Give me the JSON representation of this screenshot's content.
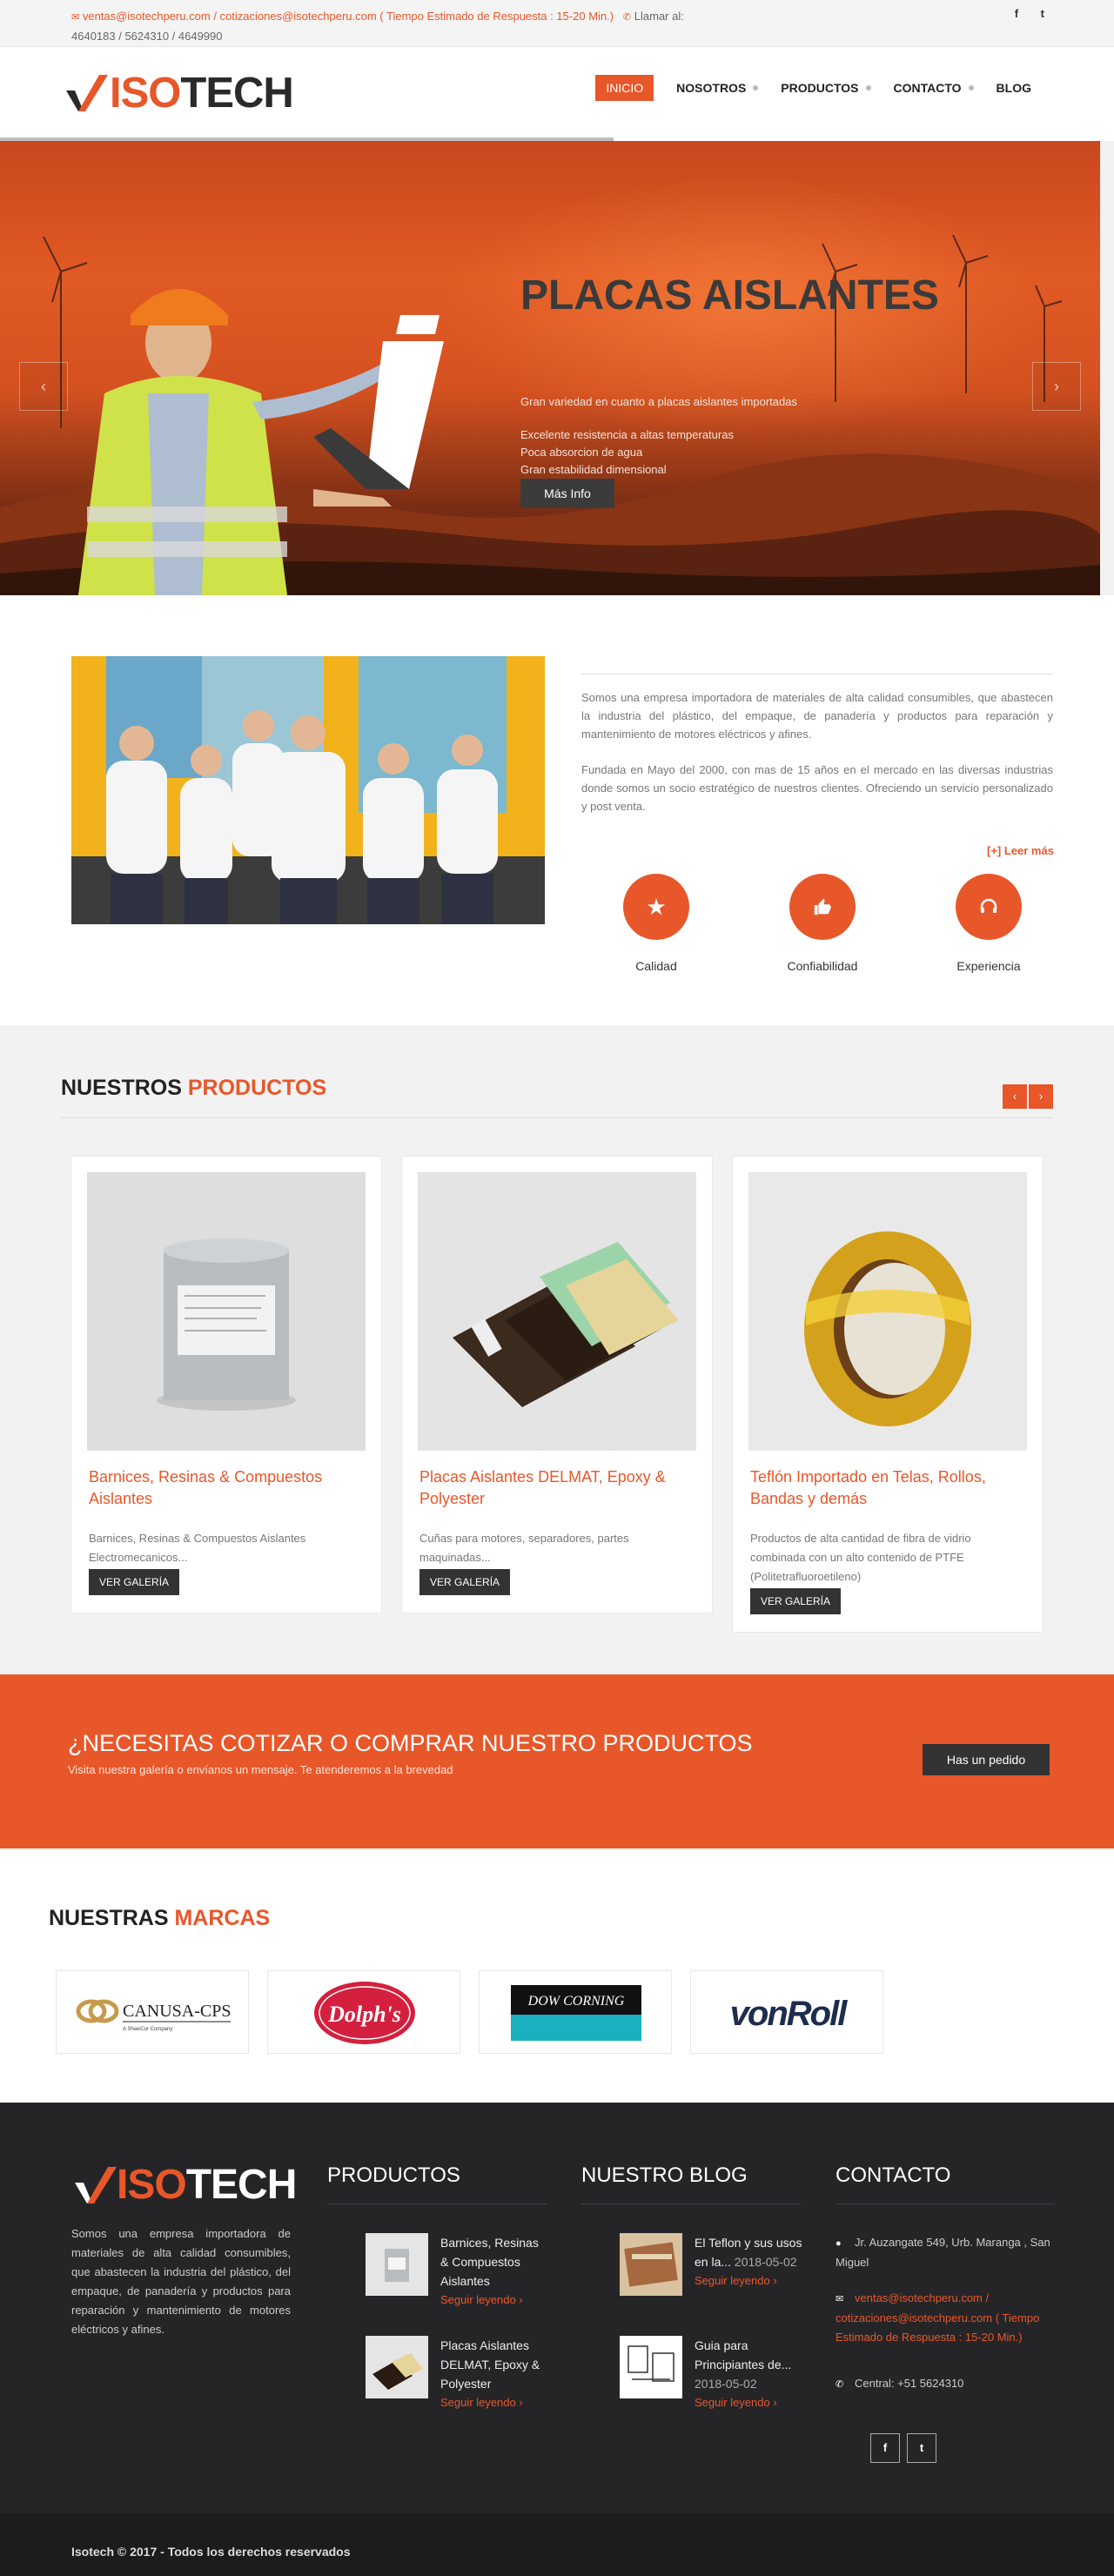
{
  "topbar": {
    "email_text": "ventas@isotechperu.com / cotizaciones@isotechperu.com ( Tiempo Estimado de Respuesta : 15-20 Min.)",
    "call_label": "Llamar al:",
    "phones": "4640183 / 5624310 / 4649990",
    "social": [
      "f",
      "t"
    ]
  },
  "header": {
    "logo_prefix": "ISO",
    "logo_suffix": "TECH",
    "nav": [
      {
        "label": "INICIO"
      },
      {
        "label": "NOSOTROS"
      },
      {
        "label": "PRODUCTOS"
      },
      {
        "label": "CONTACTO"
      },
      {
        "label": "BLOG"
      }
    ]
  },
  "hero": {
    "title": "PLACAS AISLANTES",
    "line1": "Gran variedad en cuanto a placas aislantes importadas",
    "line2": "Excelente resistencia a altas temperaturas",
    "line3": "Poca absorcion de agua",
    "line4": "Gran estabilidad dimensional",
    "button": "Más Info",
    "prev": "‹",
    "next": "›"
  },
  "about": {
    "para1": "Somos una empresa importadora de materiales de alta calidad consumibles, que abastecen la industria del plástico, del empaque, de panadería y productos para reparación y mantenimiento de motores eléctricos y afines.",
    "para2": "Fundada en Mayo del 2000, con mas de 15 años en el mercado en las diversas industrias donde somos un socio estratégico de nuestros clientes. Ofreciendo un servicio personalizado y post venta.",
    "more": "[+] Leer más",
    "features": [
      {
        "label": "Calidad",
        "icon": "star-icon"
      },
      {
        "label": "Confiabilidad",
        "icon": "thumbs-up-icon"
      },
      {
        "label": "Experiencia",
        "icon": "headset-icon"
      }
    ]
  },
  "products": {
    "heading_a": "NUESTROS",
    "heading_b": "PRODUCTOS",
    "prev": "‹",
    "next": "›",
    "items": [
      {
        "title": "Barnices, Resinas & Compuestos Aislantes",
        "desc": "Barnices, Resinas & Compuestos Aislantes Electromecanicos...",
        "button": "VER GALERÍA"
      },
      {
        "title": "Placas Aislantes DELMAT, Epoxy & Polyester",
        "desc": "Cuñas para motores, separadores, partes maquinadas...",
        "button": "VER GALERÍA"
      },
      {
        "title": "Teflón Importado en Telas, Rollos, Bandas y demás",
        "desc": "Productos de alta cantidad de fibra de vidrio combinada con un alto contenido de PTFE (Politetrafluoroetileno)",
        "button": "VER GALERÍA"
      }
    ]
  },
  "cta": {
    "title": "¿NECESITAS COTIZAR O COMPRAR NUESTRO PRODUCTOS",
    "subtitle": "Visita nuestra galería o envíanos un mensaje. Te atenderemos a la brevedad",
    "button": "Has un pedido"
  },
  "brands": {
    "heading_a": "NUESTRAS",
    "heading_b": "MARCAS",
    "items": [
      "CANUSA-CPS",
      "Dolph's",
      "DOW CORNING",
      "vonRoll"
    ],
    "canusa_sub": "A ShawCor Company"
  },
  "footer": {
    "logo_prefix": "ISO",
    "logo_suffix": "TECH",
    "about": "Somos una empresa importadora de materiales de alta calidad consumibles, que abastecen la industria del plástico, del empaque, de panadería y productos para reparación y mantenimiento de motores eléctricos y afines.",
    "products_title": "PRODUCTOS",
    "products": [
      {
        "title": "Barnices, Resinas & Compuestos Aislantes",
        "more": "Seguir leyendo ›"
      },
      {
        "title": "Placas Aislantes DELMAT, Epoxy & Polyester",
        "more": "Seguir leyendo ›"
      }
    ],
    "blog_title": "NUESTRO BLOG",
    "blog": [
      {
        "title": "El Teflon y sus usos en la...",
        "date": "2018-05-02",
        "more": "Seguir leyendo ›"
      },
      {
        "title": "Guia para Principiantes de...",
        "date": "2018-05-02",
        "more": "Seguir leyendo ›"
      }
    ],
    "contact_title": "CONTACTO",
    "address": "Jr. Auzangate 549, Urb. Maranga , San Miguel",
    "email": "ventas@isotechperu.com / cotizaciones@isotechperu.com ( Tiempo Estimado de Respuesta : 15-20 Min.)",
    "phone": "Central: +51 5624310",
    "social": [
      "f",
      "t"
    ]
  },
  "bottom": {
    "copyright": "Isotech © 2017 - Todos los derechos reservados"
  },
  "colors": {
    "accent": "#e8572a",
    "dark": "#252528"
  }
}
